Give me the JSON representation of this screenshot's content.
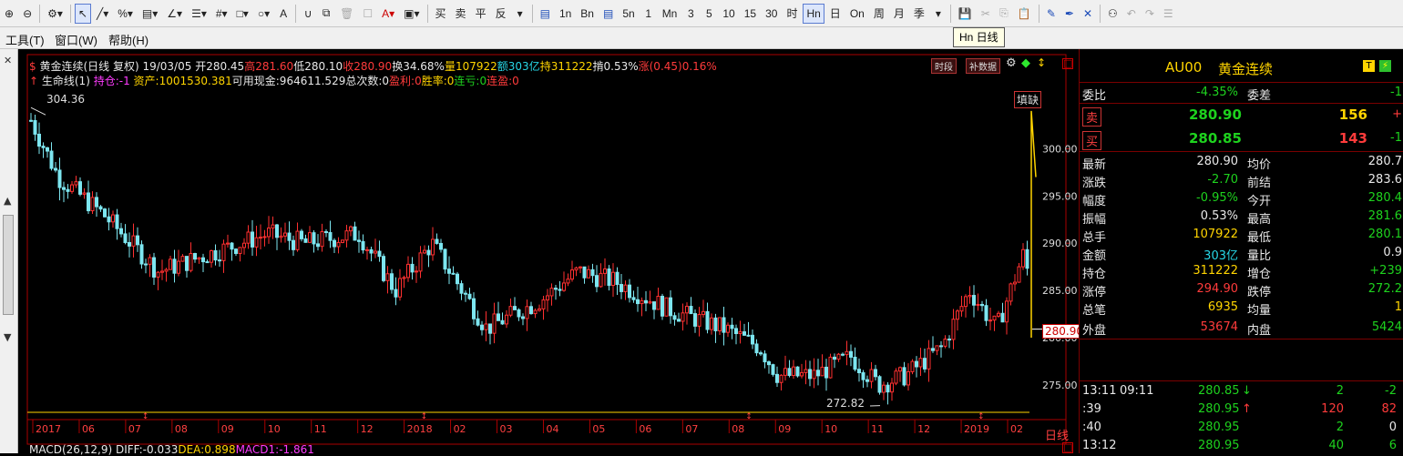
{
  "toolbar": {
    "items": [
      "🔍+",
      "🔍-",
      "⚙",
      "▾",
      "↖",
      "╱",
      "%",
      "▤",
      "∠",
      "☰",
      "#",
      "□",
      "○",
      "A",
      "U",
      "⧉",
      "🗑",
      "☐",
      "A",
      "▣"
    ],
    "trade": [
      "买",
      "卖",
      "平",
      "反"
    ],
    "periods": [
      "1m",
      "5m",
      "15m",
      "30m",
      "60m",
      "Hn",
      "日",
      "周",
      "月",
      "季"
    ],
    "period_labels": [
      "≣",
      "1n",
      "←",
      "Bn",
      "↑",
      "5n",
      "1",
      "Mn",
      "3",
      "5",
      "10",
      "15",
      "30",
      "时",
      "Hn",
      "日",
      "On",
      "周",
      "月",
      "季"
    ]
  },
  "menu": {
    "tools": "工具(T)",
    "window": "窗口(W)",
    "help": "帮助(H)"
  },
  "tooltip": "Hn 日线",
  "close_x": "×",
  "chart_header": {
    "symbol": "黄金连续(日线 复权)",
    "date": "19/03/05",
    "open": "开280.45",
    "high": "高281.60",
    "low": "低280.10",
    "close": "收280.90",
    "turnover": "换34.68%",
    "volume": "量107922",
    "amount": "额303亿",
    "hold": "持311222",
    "amplitude": "掯0.53%",
    "change": "涨(0.45)0.16%",
    "btn_period": "时段",
    "btn_supplement": "补数据"
  },
  "chart_header2": {
    "lifeline": "生命线(1)",
    "position": "持仓:-1",
    "assets": "资产:1001530.381",
    "cash": "可用现金:964611.529",
    "total_trades": "总次数:0",
    "profit": "盈利:0",
    "win_rate": "胜率:0",
    "consec_loss": "连亏:0",
    "consec_win": "连盈:0"
  },
  "chart_labels": {
    "max_label": "304.36",
    "min_label": "272.82",
    "fill_gap": "填缺",
    "last_price": "280.90",
    "daily": "日线"
  },
  "macd_line": {
    "name": "MACD(26,12,9)",
    "diff": "DIFF:-0.033",
    "dea": "DEA:0.898",
    "macd": "MACD1:-1.861"
  },
  "chart_data": {
    "type": "candlestick",
    "y_ticks": [
      275,
      280,
      285,
      290,
      295,
      300
    ],
    "ylim": [
      272.2,
      306.3
    ],
    "x_ticks": [
      "2017",
      "06",
      "07",
      "08",
      "09",
      "10",
      "11",
      "12",
      "2018",
      "02",
      "03",
      "04",
      "05",
      "06",
      "07",
      "08",
      "09",
      "10",
      "11",
      "12",
      "2019",
      "02"
    ],
    "high": 304.36,
    "low": 272.82,
    "last": 280.9,
    "colors": {
      "up": "#ff3030",
      "down": "#7de6f0"
    }
  },
  "right_panel": {
    "code": "AU00",
    "name": "黄金连续",
    "badge": "T",
    "weibi_label": "委比",
    "weibi_value": "-4.35%",
    "weicha_label": "委差",
    "weicha_value": "-1",
    "sell_label": "卖",
    "sell_price": "280.90",
    "sell_vol": "156",
    "sell_mark": "+",
    "buy_label": "买",
    "buy_price": "280.85",
    "buy_vol": "143",
    "buy_mark": "-1",
    "rows": [
      {
        "l1": "最新",
        "v1": "280.90",
        "c1": "white",
        "l2": "均价",
        "v2": "280.7",
        "c2": "white"
      },
      {
        "l1": "涨跌",
        "v1": "-2.70",
        "c1": "green",
        "l2": "前结",
        "v2": "283.6",
        "c2": "white"
      },
      {
        "l1": "幅度",
        "v1": "-0.95%",
        "c1": "green",
        "l2": "今开",
        "v2": "280.4",
        "c2": "green"
      },
      {
        "l1": "振幅",
        "v1": "0.53%",
        "c1": "white",
        "l2": "最高",
        "v2": "281.6",
        "c2": "green"
      },
      {
        "l1": "总手",
        "v1": "107922",
        "c1": "yellow",
        "l2": "最低",
        "v2": "280.1",
        "c2": "green"
      },
      {
        "l1": "金额",
        "v1": "303亿",
        "c1": "cyan",
        "l2": "量比",
        "v2": "0.9",
        "c2": "white"
      },
      {
        "l1": "持仓",
        "v1": "311222",
        "c1": "yellow",
        "l2": "增仓",
        "v2": "+239",
        "c2": "green"
      },
      {
        "l1": "涨停",
        "v1": "294.90",
        "c1": "red",
        "l2": "跌停",
        "v2": "272.2",
        "c2": "green"
      },
      {
        "l1": "总笔",
        "v1": "6935",
        "c1": "yellow",
        "l2": "均量",
        "v2": "1",
        "c2": "yellow"
      }
    ],
    "outer_label": "外盘",
    "outer_value": "53674",
    "inner_label": "内盘",
    "inner_value": "5424",
    "ticks": [
      {
        "time": "13:11",
        "time2": "09:11",
        "price": "280.85",
        "arrow": "↓",
        "vol": "2",
        "chg": "-2"
      },
      {
        "time": ":39",
        "time2": "",
        "price": "280.95",
        "arrow": "↑",
        "vol": "120",
        "chg": "82"
      },
      {
        "time": ":40",
        "time2": "",
        "price": "280.95",
        "arrow": "",
        "vol": "2",
        "chg": "0"
      },
      {
        "time": "13:12",
        "time2": "",
        "price": "280.95",
        "arrow": "",
        "vol": "40",
        "chg": "6"
      }
    ]
  }
}
